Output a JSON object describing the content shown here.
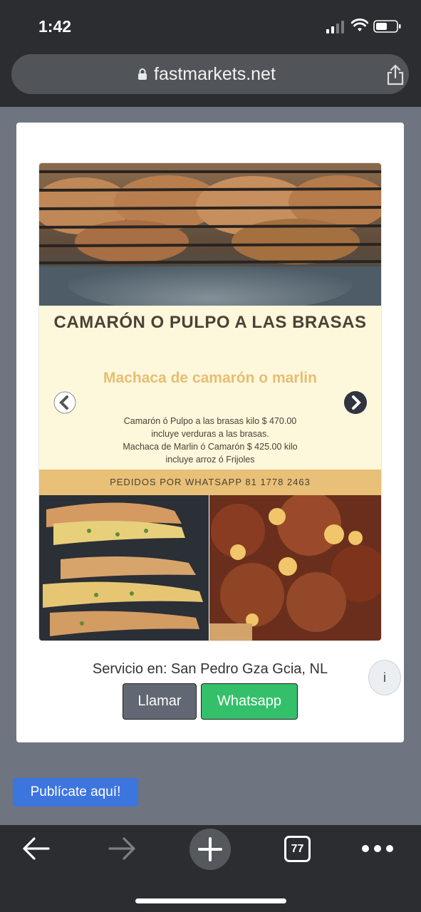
{
  "status_bar": {
    "time": "1:42",
    "signal_icon": "cellular-signal-icon",
    "wifi_icon": "wifi-icon",
    "battery_icon": "battery-icon"
  },
  "browser": {
    "url": "fastmarkets.net",
    "lock_icon": "lock-icon",
    "share_icon": "share-icon"
  },
  "ad": {
    "title": "CAMARÓN O PULPO A LAS BRASAS",
    "subtitle": "Machaca de camarón o marlin",
    "description_lines": [
      "Camarón ó Pulpo a las brasas kilo $ 470.00",
      "incluye verduras a las brasas.",
      "Machaca de Marlin ó Camarón $ 425.00 kilo",
      "incluye arroz ó Frijoles"
    ],
    "footer": "PEDIDOS POR WHATSAPP 81 1778 2463",
    "colors": {
      "cream": "#fdf7dc",
      "accent": "#e6be72",
      "footer_bg": "#e9c077",
      "text": "#4a4236"
    }
  },
  "listing": {
    "service_text": "Servicio en: San Pedro Gza Gcia, NL",
    "call_label": "Llamar",
    "whatsapp_label": "Whatsapp",
    "info_label": "i"
  },
  "publicate_label": "Publícate aquí!",
  "toolbar": {
    "tabs_count": "77"
  }
}
